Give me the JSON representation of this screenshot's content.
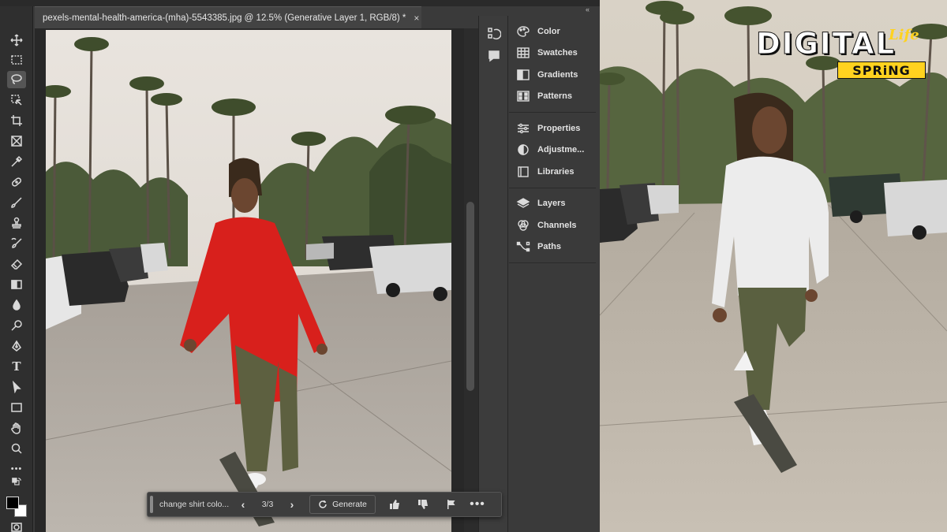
{
  "document": {
    "tab_title": "pexels-mental-health-america-(mha)-5543385.jpg @ 12.5% (Generative Layer 1, RGB/8) *",
    "close_glyph": "×"
  },
  "toolbar": {
    "expand_glyph": "»",
    "tools": [
      "move-tool",
      "marquee-tool",
      "lasso-tool",
      "object-selection-tool",
      "crop-tool",
      "frame-tool",
      "eyedropper-tool",
      "spot-healing-tool",
      "brush-tool",
      "clone-stamp-tool",
      "history-brush-tool",
      "eraser-tool",
      "gradient-tool",
      "blur-tool",
      "dodge-tool",
      "pen-tool",
      "type-tool",
      "path-selection-tool",
      "rectangle-tool",
      "hand-tool",
      "zoom-tool",
      "more-tools"
    ],
    "active_tool": "lasso-tool",
    "type_glyph": "T",
    "more_glyph": "•••"
  },
  "panels": {
    "collapse_glyph": "«",
    "groups": [
      [
        {
          "label": "Color",
          "icon": "color-icon"
        },
        {
          "label": "Swatches",
          "icon": "swatches-icon"
        },
        {
          "label": "Gradients",
          "icon": "gradients-icon"
        },
        {
          "label": "Patterns",
          "icon": "patterns-icon"
        }
      ],
      [
        {
          "label": "Properties",
          "icon": "properties-icon"
        },
        {
          "label": "Adjustme...",
          "icon": "adjustments-icon"
        },
        {
          "label": "Libraries",
          "icon": "libraries-icon"
        }
      ],
      [
        {
          "label": "Layers",
          "icon": "layers-icon"
        },
        {
          "label": "Channels",
          "icon": "channels-icon"
        },
        {
          "label": "Paths",
          "icon": "paths-icon"
        }
      ]
    ]
  },
  "generative_bar": {
    "prompt": "change shirt colo...",
    "prev_glyph": "‹",
    "next_glyph": "›",
    "counter": "3/3",
    "generate_label": "Generate",
    "more_glyph": "•••"
  },
  "logo": {
    "digital": "DIGITAL",
    "life": "Life",
    "spring": "SPRiNG"
  },
  "colors": {
    "shirt_left": "#d8201c",
    "hoodie_right": "#ececec",
    "logo_accent": "#ffd21f",
    "foreground_swatch": "#000000",
    "background_swatch": "#ffffff"
  }
}
